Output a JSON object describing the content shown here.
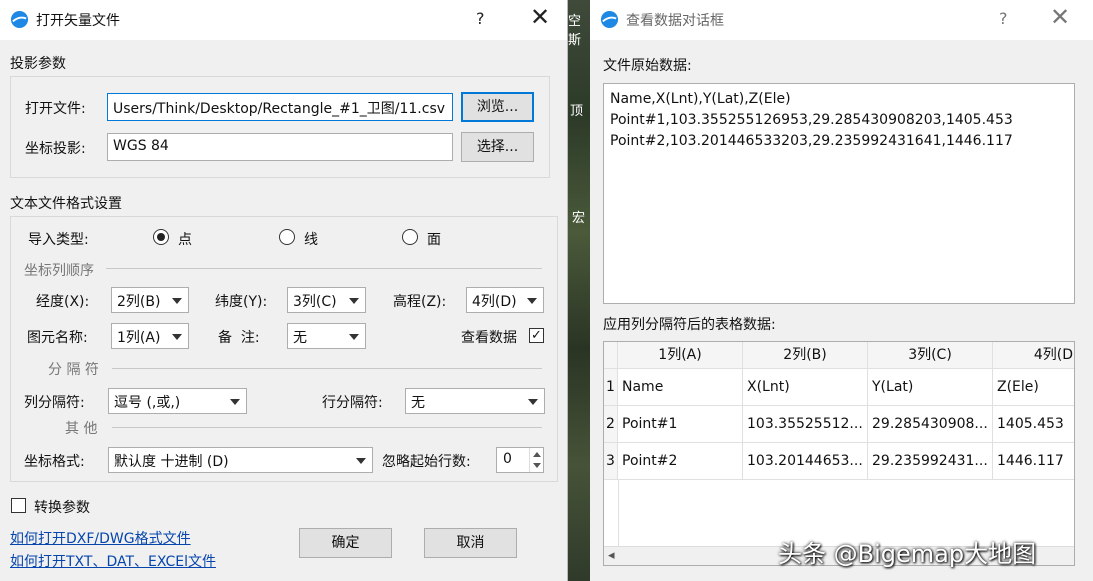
{
  "background": {
    "map_labels": [
      "空斯",
      "顶",
      "宏"
    ]
  },
  "dialog1": {
    "title": "打开矢量文件",
    "help": "?",
    "close": "✕",
    "projection_section": "投影参数",
    "open_file_label": "打开文件:",
    "open_file_value": "Users/Think/Desktop/Rectangle_#1_卫图/11.csv",
    "browse_button": "浏览...",
    "coord_proj_label": "坐标投影:",
    "coord_proj_value": "WGS 84",
    "select_button": "选择...",
    "format_section": "文本文件格式设置",
    "import_type_label": "导入类型:",
    "import_types": [
      "点",
      "线",
      "面"
    ],
    "import_type_selected": "点",
    "coord_order_header": "坐标列顺序",
    "lon_label": "经度(X):",
    "lon_value": "2列(B)",
    "lat_label": "纬度(Y):",
    "lat_value": "3列(C)",
    "ele_label": "高程(Z):",
    "ele_value": "4列(D)",
    "name_label": "图元名称:",
    "name_value": "1列(A)",
    "remark_label": "备  注:",
    "remark_value": "无",
    "view_data_label": "查看数据",
    "view_data_checked": true,
    "delimiter_header": "分 隔 符",
    "col_delim_label": "列分隔符:",
    "col_delim_value": "逗号 (,或,)",
    "row_delim_label": "行分隔符:",
    "row_delim_value": "无",
    "other_header": "其 他",
    "coord_format_label": "坐标格式:",
    "coord_format_value": "默认度 十进制 (D)",
    "skip_rows_label": "忽略起始行数:",
    "skip_rows_value": "0",
    "convert_label": "转换参数",
    "link_dxf": "如何打开DXF/DWG格式文件",
    "link_txt": "如何打开TXT、DAT、EXCEl文件",
    "ok_button": "确定",
    "cancel_button": "取消"
  },
  "dialog2": {
    "title": "查看数据对话框",
    "help": "?",
    "close": "✕",
    "raw_label": "文件原始数据:",
    "raw_lines": [
      "Name,X(Lnt),Y(Lat),Z(Ele)",
      "Point#1,103.355255126953,29.285430908203,1405.453",
      "Point#2,103.201446533203,29.235992431641,1446.117"
    ],
    "table_label": "应用列分隔符后的表格数据:",
    "columns": [
      "1列(A)",
      "2列(B)",
      "3列(C)",
      "4列(D"
    ],
    "rows": [
      {
        "num": "1",
        "cells": [
          "Name",
          "X(Lnt)",
          "Y(Lat)",
          "Z(Ele)"
        ]
      },
      {
        "num": "2",
        "cells": [
          "Point#1",
          "103.35525512...",
          "29.285430908...",
          "1405.453"
        ]
      },
      {
        "num": "3",
        "cells": [
          "Point#2",
          "103.20144653...",
          "29.235992431...",
          "1446.117"
        ]
      }
    ],
    "scroll_left": "◂"
  },
  "watermark": "头条 @Bigemap大地图"
}
